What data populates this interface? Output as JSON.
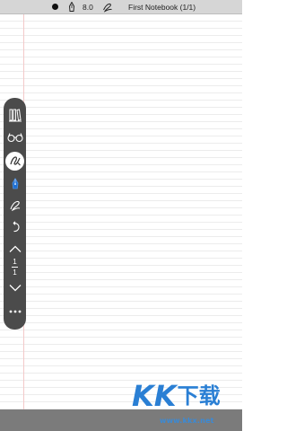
{
  "status_bar": {
    "color_dot": "#111111",
    "pen_icon": "pen-nib-icon",
    "pen_size": "8.0",
    "ink_icon": "ink-stroke-icon",
    "notebook_title": "First Notebook (1/1)"
  },
  "toolbar": {
    "items": [
      {
        "icon": "library-icon"
      },
      {
        "icon": "glasses-icon"
      },
      {
        "icon": "ink-mode-icon",
        "active": true
      },
      {
        "icon": "pen-icon"
      },
      {
        "icon": "highlighter-icon"
      },
      {
        "icon": "undo-icon"
      },
      {
        "icon": "page-up-icon"
      },
      {
        "icon": "page-down-icon"
      },
      {
        "icon": "more-icon"
      }
    ],
    "page_current": "1",
    "page_total": "1"
  },
  "colors": {
    "paper": "#ffffff",
    "rule_line": "#ececec",
    "margin_line": "#f3c9c9",
    "toolbar_bg": "#4b4b4b",
    "status_bar_bg": "#d6d6d6",
    "bottom_bar_bg": "#7b7b7b",
    "watermark_blue": "#2a7fd4"
  },
  "watermark": {
    "logo_text": "KK下载",
    "url": "www.kkx.net"
  }
}
